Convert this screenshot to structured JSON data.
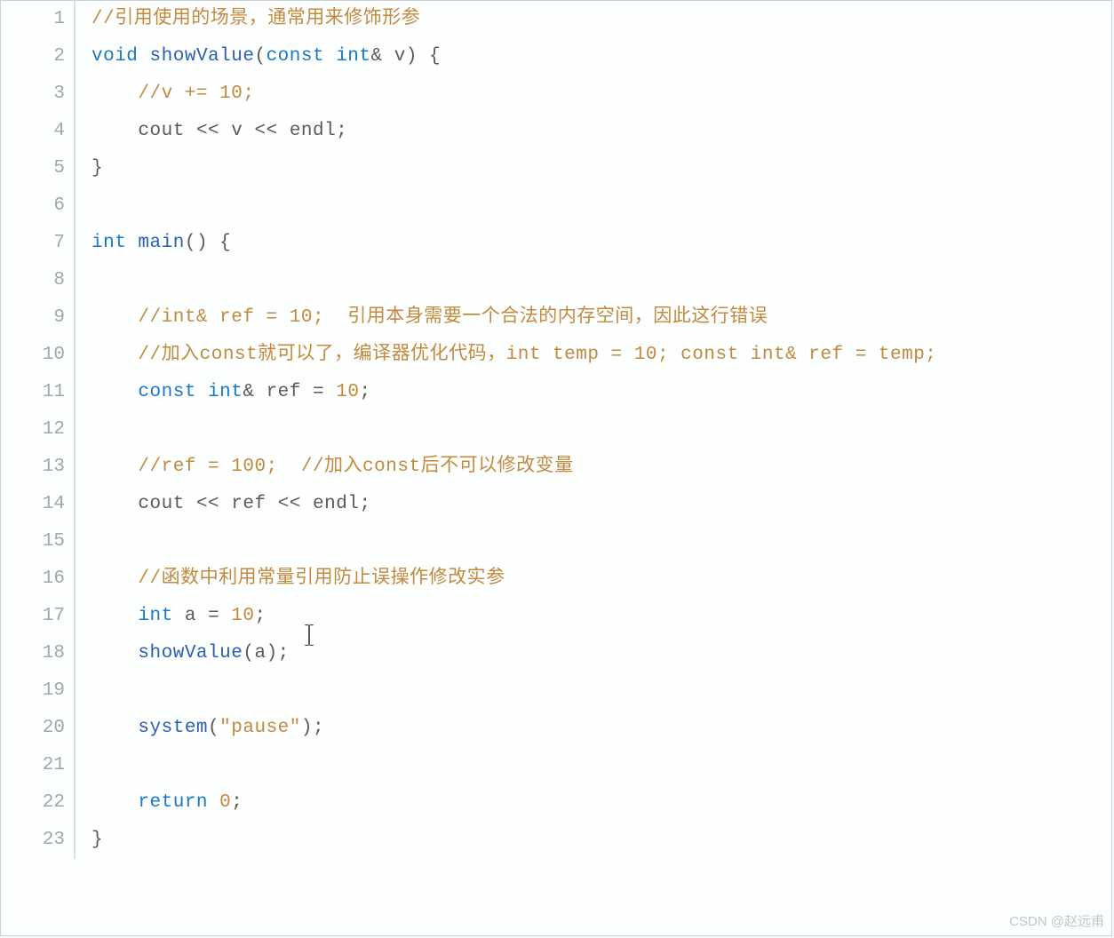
{
  "watermark": "CSDN @赵远甫",
  "lines": [
    {
      "n": "1",
      "tokens": [
        [
          "comment",
          "//引用使用的场景，通常用来修饰形参"
        ]
      ]
    },
    {
      "n": "2",
      "tokens": [
        [
          "keyword",
          "void"
        ],
        [
          "plain",
          " "
        ],
        [
          "func",
          "showValue"
        ],
        [
          "punct",
          "("
        ],
        [
          "keyword",
          "const"
        ],
        [
          "plain",
          " "
        ],
        [
          "type",
          "int"
        ],
        [
          "punct",
          "&"
        ],
        [
          "plain",
          " "
        ],
        [
          "ident",
          "v"
        ],
        [
          "punct",
          ") {"
        ]
      ]
    },
    {
      "n": "3",
      "tokens": [
        [
          "plain",
          "    "
        ],
        [
          "comment",
          "//v += 10;"
        ]
      ]
    },
    {
      "n": "4",
      "tokens": [
        [
          "plain",
          "    "
        ],
        [
          "ident",
          "cout"
        ],
        [
          "plain",
          " "
        ],
        [
          "punct",
          "<<"
        ],
        [
          "plain",
          " "
        ],
        [
          "ident",
          "v"
        ],
        [
          "plain",
          " "
        ],
        [
          "punct",
          "<<"
        ],
        [
          "plain",
          " "
        ],
        [
          "ident",
          "endl"
        ],
        [
          "punct",
          ";"
        ]
      ]
    },
    {
      "n": "5",
      "tokens": [
        [
          "punct",
          "}"
        ]
      ]
    },
    {
      "n": "6",
      "tokens": []
    },
    {
      "n": "7",
      "tokens": [
        [
          "type",
          "int"
        ],
        [
          "plain",
          " "
        ],
        [
          "func",
          "main"
        ],
        [
          "punct",
          "() {"
        ]
      ]
    },
    {
      "n": "8",
      "tokens": []
    },
    {
      "n": "9",
      "tokens": [
        [
          "plain",
          "    "
        ],
        [
          "comment",
          "//int& ref = 10;  引用本身需要一个合法的内存空间，因此这行错误"
        ]
      ]
    },
    {
      "n": "10",
      "tokens": [
        [
          "plain",
          "    "
        ],
        [
          "comment",
          "//加入const就可以了，编译器优化代码，int temp = 10; const int& ref = temp;"
        ]
      ]
    },
    {
      "n": "11",
      "tokens": [
        [
          "plain",
          "    "
        ],
        [
          "keyword",
          "const"
        ],
        [
          "plain",
          " "
        ],
        [
          "type",
          "int"
        ],
        [
          "punct",
          "&"
        ],
        [
          "plain",
          " "
        ],
        [
          "ident",
          "ref"
        ],
        [
          "plain",
          " "
        ],
        [
          "punct",
          "="
        ],
        [
          "plain",
          " "
        ],
        [
          "number",
          "10"
        ],
        [
          "punct",
          ";"
        ]
      ]
    },
    {
      "n": "12",
      "tokens": []
    },
    {
      "n": "13",
      "tokens": [
        [
          "plain",
          "    "
        ],
        [
          "comment",
          "//ref = 100;  //加入const后不可以修改变量"
        ]
      ]
    },
    {
      "n": "14",
      "tokens": [
        [
          "plain",
          "    "
        ],
        [
          "ident",
          "cout"
        ],
        [
          "plain",
          " "
        ],
        [
          "punct",
          "<<"
        ],
        [
          "plain",
          " "
        ],
        [
          "ident",
          "ref"
        ],
        [
          "plain",
          " "
        ],
        [
          "punct",
          "<<"
        ],
        [
          "plain",
          " "
        ],
        [
          "ident",
          "endl"
        ],
        [
          "punct",
          ";"
        ]
      ]
    },
    {
      "n": "15",
      "tokens": []
    },
    {
      "n": "16",
      "tokens": [
        [
          "plain",
          "    "
        ],
        [
          "comment",
          "//函数中利用常量引用防止误操作修改实参"
        ]
      ]
    },
    {
      "n": "17",
      "tokens": [
        [
          "plain",
          "    "
        ],
        [
          "type",
          "int"
        ],
        [
          "plain",
          " "
        ],
        [
          "ident",
          "a"
        ],
        [
          "plain",
          " "
        ],
        [
          "punct",
          "="
        ],
        [
          "plain",
          " "
        ],
        [
          "number",
          "10"
        ],
        [
          "punct",
          ";"
        ]
      ]
    },
    {
      "n": "18",
      "tokens": [
        [
          "plain",
          "    "
        ],
        [
          "func",
          "showValue"
        ],
        [
          "punct",
          "("
        ],
        [
          "ident",
          "a"
        ],
        [
          "punct",
          ");"
        ]
      ]
    },
    {
      "n": "19",
      "tokens": []
    },
    {
      "n": "20",
      "tokens": [
        [
          "plain",
          "    "
        ],
        [
          "func",
          "system"
        ],
        [
          "punct",
          "("
        ],
        [
          "string",
          "\"pause\""
        ],
        [
          "punct",
          ");"
        ]
      ]
    },
    {
      "n": "21",
      "tokens": []
    },
    {
      "n": "22",
      "tokens": [
        [
          "plain",
          "    "
        ],
        [
          "keyword",
          "return"
        ],
        [
          "plain",
          " "
        ],
        [
          "number",
          "0"
        ],
        [
          "punct",
          ";"
        ]
      ]
    },
    {
      "n": "23",
      "tokens": [
        [
          "punct",
          "}"
        ]
      ]
    }
  ]
}
